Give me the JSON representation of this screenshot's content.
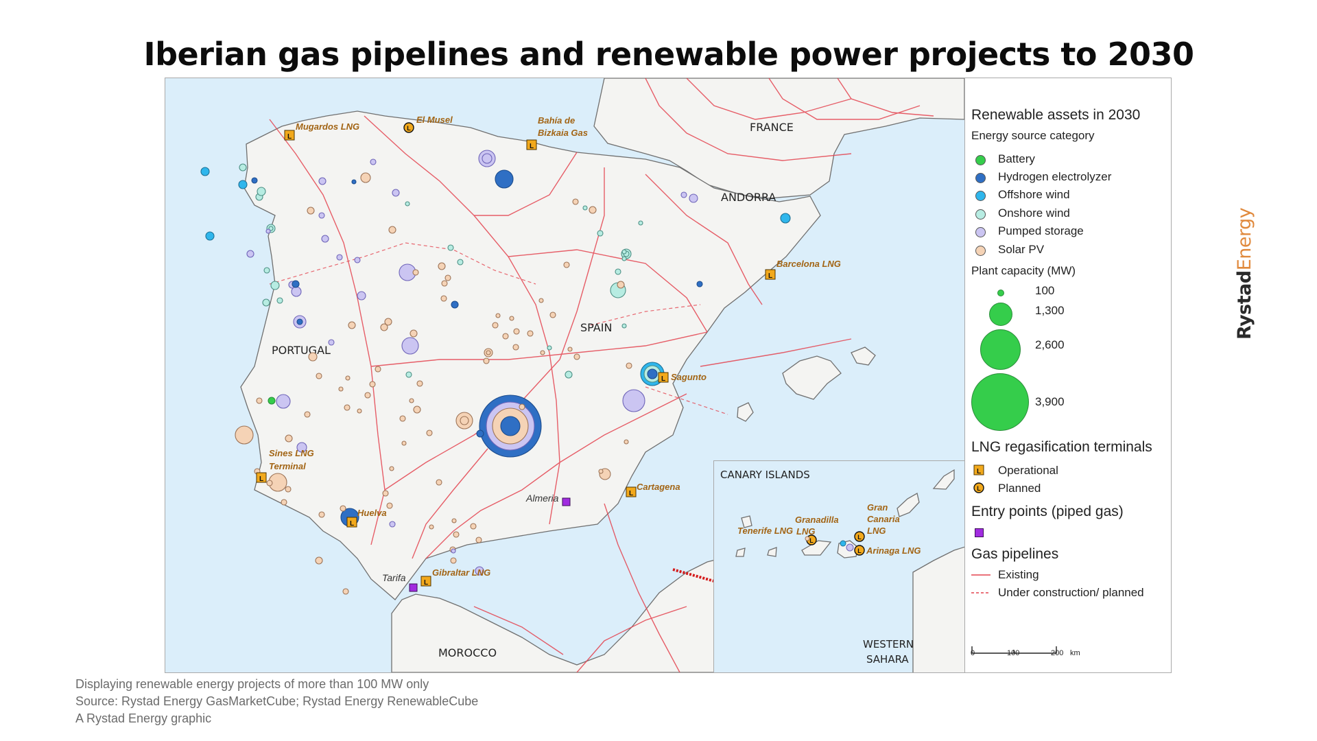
{
  "title": "Iberian gas pipelines and renewable power projects to 2030",
  "brand": {
    "part1": "Rystad",
    "part2": "Energy"
  },
  "map": {
    "countries": {
      "france": "FRANCE",
      "andorra": "ANDORRA",
      "spain": "SPAIN",
      "portugal": "PORTUGAL",
      "morocco": "MOROCCO",
      "western_sahara_1": "WESTERN",
      "western_sahara_2": "SAHARA"
    },
    "terminals": {
      "mugardos": "Mugardos LNG",
      "el_musel": "El Musel",
      "bahia_1": "Bahía de",
      "bahia_2": "Bizkaia Gas",
      "barcelona": "Barcelona LNG",
      "sagunto": "Sagunto",
      "cartagena": "Cartagena",
      "huelva": "Huelva",
      "gibraltar": "Gibraltar LNG",
      "sines_1": "Sines LNG",
      "sines_2": "Terminal"
    },
    "entry_points": {
      "almeria": "Almeria",
      "tarifa": "Tarifa"
    },
    "inset": {
      "title": "CANARY ISLANDS",
      "tenerife": "Tenerife LNG",
      "granadilla_1": "Granadilla",
      "granadilla_2": "LNG",
      "gran_canaria_1": "Gran",
      "gran_canaria_2": "Canaria",
      "gran_canaria_3": "LNG",
      "arinaga": "Arinaga LNG"
    },
    "colors": {
      "sea": "#dbeefa",
      "land": "#f4f4f2",
      "pipeline": "#e4434f",
      "battery": "#35cd4b",
      "hydrogen": "#2f6fc4",
      "offshore": "#2fb6ec",
      "onshore": "#b7ece2",
      "pumped": "#cbc5f2",
      "solar": "#f5d3b6",
      "terminal": "#f2a91c",
      "entry": "#a12ce0"
    }
  },
  "legend": {
    "title": "Renewable assets in 2030",
    "category_title": "Energy source category",
    "categories": [
      "Battery",
      "Hydrogen electrolyzer",
      "Offshore wind",
      "Onshore wind",
      "Pumped storage",
      "Solar PV"
    ],
    "capacity_title": "Plant capacity (MW)",
    "capacities": [
      "100",
      "1,300",
      "2,600",
      "3,900"
    ],
    "lng_title": "LNG regasification terminals",
    "lng_items": [
      "Operational",
      "Planned"
    ],
    "entry_title": "Entry points (piped gas)",
    "pipeline_title": "Gas pipelines",
    "pipeline_items": [
      "Existing",
      "Under construction/ planned"
    ],
    "scale": {
      "ticks": [
        "0",
        "100",
        "200"
      ],
      "unit": "km"
    }
  },
  "footer": {
    "line1": "Displaying renewable energy projects of more than 100 MW only",
    "line2": "Source: Rystad Energy GasMarketCube; Rystad Energy RenewableCube",
    "line3": "A Rystad Energy graphic"
  }
}
